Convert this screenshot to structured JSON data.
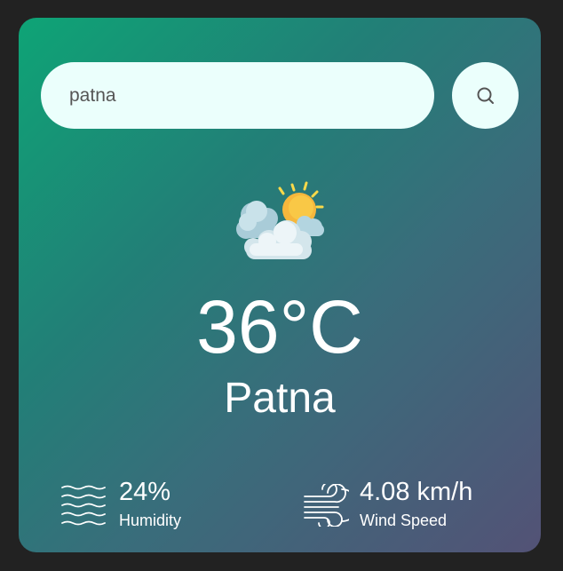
{
  "search": {
    "value": "patna",
    "button_icon": "search-icon"
  },
  "weather": {
    "icon": "partly-cloudy-sun-icon",
    "temperature": "36°C",
    "city": "Patna"
  },
  "details": {
    "humidity": {
      "icon": "humidity-waves-icon",
      "value": "24%",
      "label": "Humidity"
    },
    "wind": {
      "icon": "wind-icon",
      "value": "4.08 km/h",
      "label": "Wind Speed"
    }
  },
  "colors": {
    "page_background": "#222222",
    "card_gradient_start": "#0ea476",
    "card_gradient_end": "#535276",
    "input_background": "#ebfffc",
    "text": "#ffffff",
    "sun": "#f6b73c"
  }
}
